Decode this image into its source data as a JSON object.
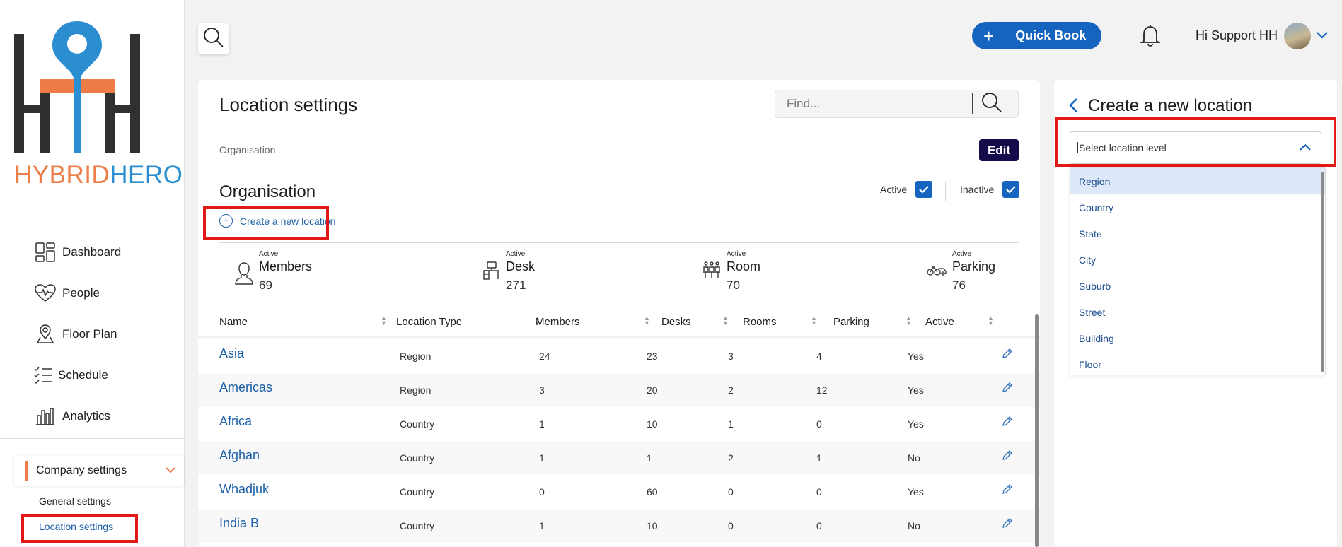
{
  "logo": {
    "part1": "HYBRID",
    "part2": "HERO",
    "colors": {
      "dark": "#303030",
      "orange": "#ed7d48",
      "blue": "#2b8ed0"
    }
  },
  "sidebar": {
    "items": [
      {
        "label": "Dashboard",
        "icon": "dashboard-icon"
      },
      {
        "label": "People",
        "icon": "heart-pulse-icon"
      },
      {
        "label": "Floor Plan",
        "icon": "map-pin-icon"
      },
      {
        "label": "Schedule",
        "icon": "checklist-icon"
      },
      {
        "label": "Analytics",
        "icon": "bar-chart-icon"
      }
    ],
    "company_settings": "Company settings",
    "sub": {
      "general": "General settings",
      "location": "Location settings"
    }
  },
  "topbar": {
    "quick_book": "Quick Book",
    "greeting": "Hi Support HH"
  },
  "main": {
    "title": "Location settings",
    "find_placeholder": "Find...",
    "breadcrumb": "Organisation",
    "edit": "Edit",
    "section_title": "Organisation",
    "filters": {
      "active": "Active",
      "inactive": "Inactive"
    },
    "create_link": "Create a new location",
    "stats": [
      {
        "small": "Active",
        "name": "Members",
        "value": "69",
        "icon": "person-icon"
      },
      {
        "small": "Active",
        "name": "Desk",
        "value": "271",
        "icon": "desk-icon"
      },
      {
        "small": "Active",
        "name": "Room",
        "value": "70",
        "icon": "meeting-room-icon"
      },
      {
        "small": "Active",
        "name": "Parking",
        "value": "76",
        "icon": "bicycle-car-icon"
      }
    ],
    "columns": [
      "Name",
      "Location Type",
      "Members",
      "Desks",
      "Rooms",
      "Parking",
      "Active"
    ],
    "rows": [
      {
        "name": "Asia",
        "type": "Region",
        "members": "24",
        "desks": "23",
        "rooms": "3",
        "parking": "4",
        "active": "Yes"
      },
      {
        "name": "Americas",
        "type": "Region",
        "members": "3",
        "desks": "20",
        "rooms": "2",
        "parking": "12",
        "active": "Yes"
      },
      {
        "name": "Africa",
        "type": "Country",
        "members": "1",
        "desks": "10",
        "rooms": "1",
        "parking": "0",
        "active": "Yes"
      },
      {
        "name": "Afghan",
        "type": "Country",
        "members": "1",
        "desks": "1",
        "rooms": "2",
        "parking": "1",
        "active": "No"
      },
      {
        "name": "Whadjuk",
        "type": "Country",
        "members": "0",
        "desks": "60",
        "rooms": "0",
        "parking": "0",
        "active": "Yes"
      },
      {
        "name": "India B",
        "type": "Country",
        "members": "1",
        "desks": "10",
        "rooms": "0",
        "parking": "0",
        "active": "No"
      }
    ]
  },
  "right_panel": {
    "title": "Create a new location",
    "select_placeholder": "Select location level",
    "options": [
      "Region",
      "Country",
      "State",
      "City",
      "Suburb",
      "Street",
      "Building",
      "Floor"
    ],
    "selected": "Region"
  },
  "colors": {
    "accent": "#1565c0",
    "link": "#1d5fa8",
    "edit_bg": "#150b4a",
    "highlight": "#e01818",
    "orange": "#ed7d48"
  }
}
